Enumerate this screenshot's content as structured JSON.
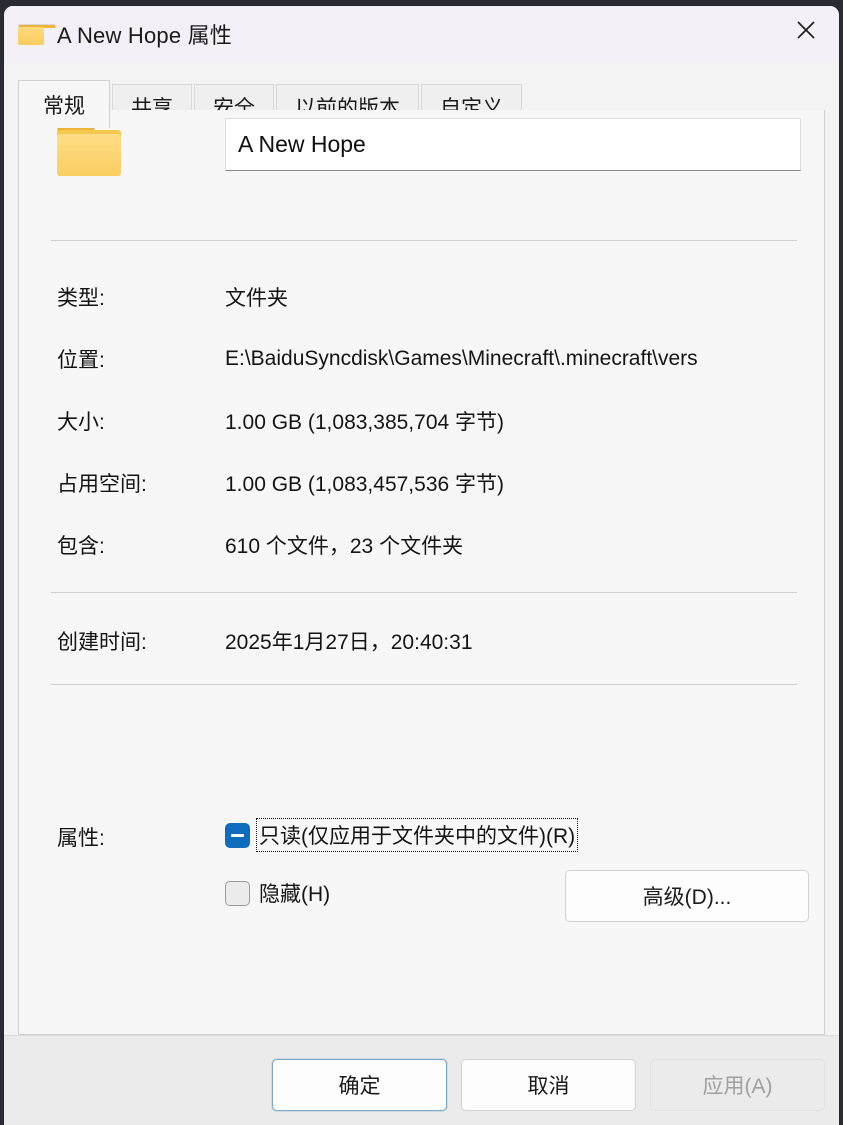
{
  "window": {
    "title": "A New Hope 属性",
    "icon": "folder-icon",
    "close_label": "✕"
  },
  "tabs": [
    {
      "label": "常规",
      "active": true
    },
    {
      "label": "共享",
      "active": false
    },
    {
      "label": "安全",
      "active": false
    },
    {
      "label": "以前的版本",
      "active": false
    },
    {
      "label": "自定义",
      "active": false
    }
  ],
  "general": {
    "name_value": "A New Hope",
    "rows": [
      {
        "label": "类型:",
        "value": "文件夹"
      },
      {
        "label": "位置:",
        "value": "E:\\BaiduSyncdisk\\Games\\Minecraft\\.minecraft\\vers"
      },
      {
        "label": "大小:",
        "value": "1.00 GB (1,083,385,704 字节)"
      },
      {
        "label": "占用空间:",
        "value": "1.00 GB (1,083,457,536 字节)"
      },
      {
        "label": "包含:",
        "value": "610 个文件，23 个文件夹"
      }
    ],
    "created": {
      "label": "创建时间:",
      "value": "2025年1月27日，20:40:31"
    },
    "attributes": {
      "label": "属性:",
      "readonly": {
        "text": "只读(仅应用于文件夹中的文件)(R)",
        "state": "indeterminate",
        "focused": true
      },
      "hidden": {
        "text": "隐藏(H)",
        "state": "unchecked",
        "focused": false
      },
      "advanced_button": "高级(D)..."
    }
  },
  "footer": {
    "ok": "确定",
    "cancel": "取消",
    "apply": "应用(A)",
    "apply_disabled": true
  },
  "colors": {
    "accent": "#0f6cbd",
    "titlebar": "#f4f0f7",
    "content": "#f7f7f7",
    "footer": "#ebebeb",
    "folder": "#f9ce62"
  }
}
